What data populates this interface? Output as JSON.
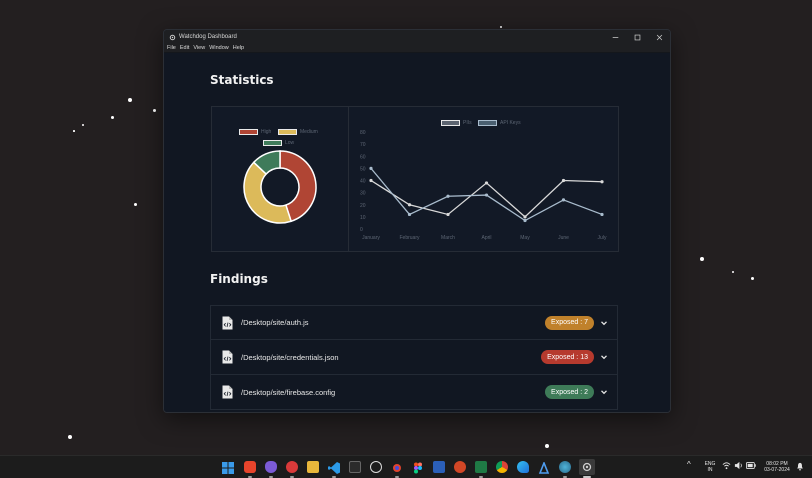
{
  "window": {
    "title": "Watchdog Dashboard",
    "menu": [
      "File",
      "Edit",
      "View",
      "Window",
      "Help"
    ]
  },
  "statistics": {
    "heading": "Statistics"
  },
  "findings": {
    "heading": "Findings",
    "items": [
      {
        "path": "/Desktop/site/auth.js",
        "badge": "Exposed : 7",
        "badge_color": "#c0812b"
      },
      {
        "path": "/Desktop/site/credentials.json",
        "badge": "Exposed : 13",
        "badge_color": "#b63a2e"
      },
      {
        "path": "/Desktop/site/firebase.config",
        "badge": "Exposed : 2",
        "badge_color": "#3e7b58"
      }
    ]
  },
  "chart_data": [
    {
      "type": "pie",
      "subtype": "doughnut",
      "legend": [
        "High",
        "Medium",
        "Low"
      ],
      "colors": [
        "#b04534",
        "#dcba5a",
        "#3f7b5a"
      ],
      "values": [
        45,
        42,
        13
      ],
      "legend_placement": "top"
    },
    {
      "type": "line",
      "categories": [
        "January",
        "February",
        "March",
        "April",
        "May",
        "June",
        "July"
      ],
      "series": [
        {
          "name": "PIIs",
          "values": [
            40,
            20,
            12,
            38,
            10,
            40,
            39
          ],
          "color": "#d9d9d9"
        },
        {
          "name": "API Keys",
          "values": [
            50,
            12,
            27,
            28,
            7,
            24,
            12
          ],
          "color": "#a9bccd"
        }
      ],
      "y_ticks": [
        "0",
        "10",
        "20",
        "30",
        "40",
        "50",
        "60",
        "70",
        "80"
      ],
      "ylim": [
        0,
        80
      ],
      "grid": false,
      "legend_placement": "top"
    }
  ],
  "taskbar": {
    "lang": "ENG",
    "region": "IN",
    "time": "08:02 PM",
    "date": "03-07-2024"
  }
}
